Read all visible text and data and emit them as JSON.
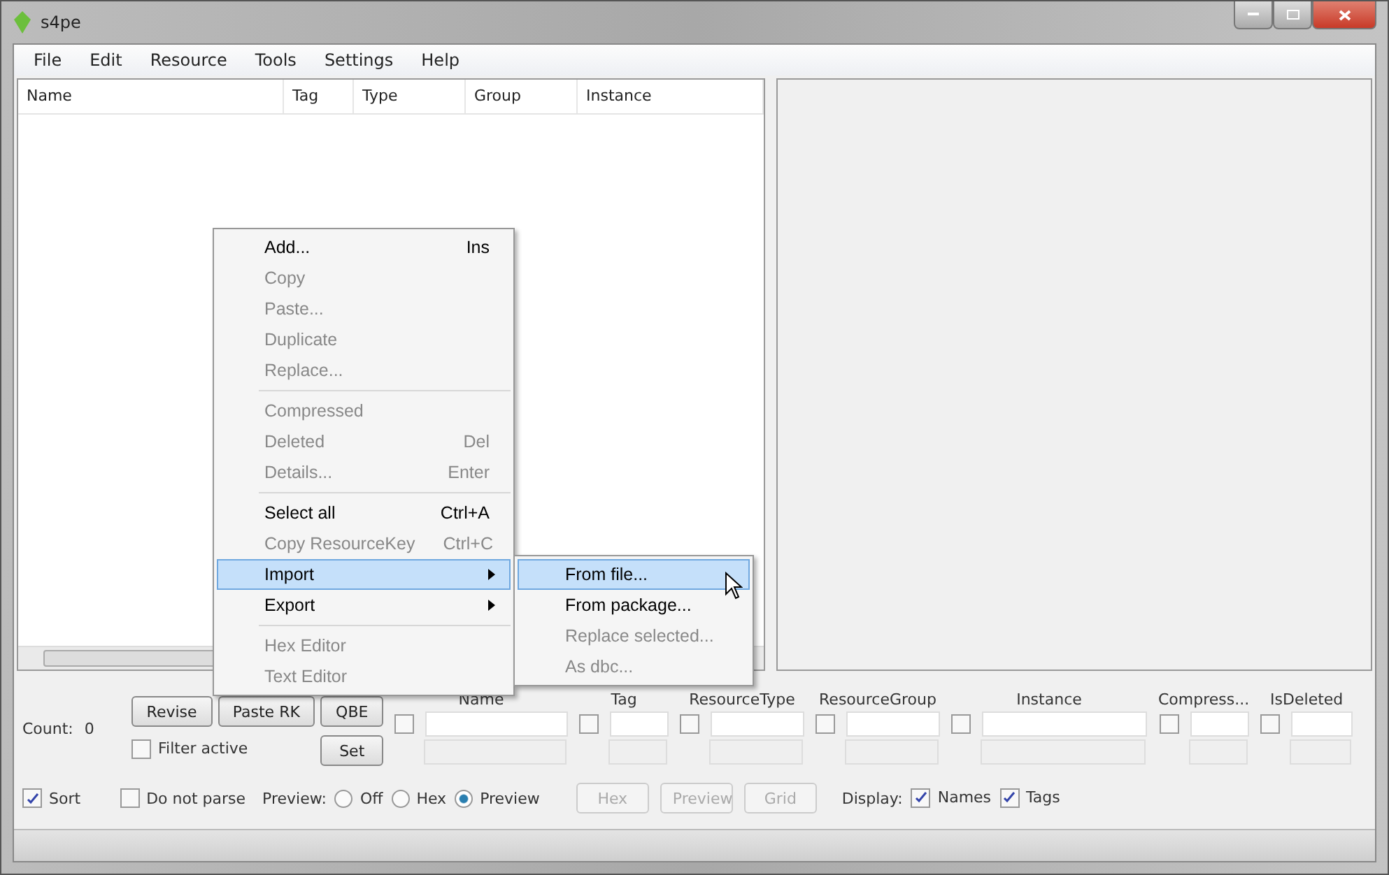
{
  "window": {
    "title": "s4pe"
  },
  "menu_bar": [
    "File",
    "Edit",
    "Resource",
    "Tools",
    "Settings",
    "Help"
  ],
  "list": {
    "columns": [
      "Name",
      "Tag",
      "Type",
      "Group",
      "Instance"
    ]
  },
  "filter_panel": {
    "count_label": "Count:",
    "count_value": "0",
    "buttons": [
      {
        "label": "Revise"
      },
      {
        "label": "Paste RK"
      },
      {
        "label": "QBE"
      },
      {
        "label": "Set"
      }
    ],
    "filter_active": {
      "label": "Filter active",
      "checked": false
    },
    "fields": [
      {
        "label": "Name",
        "checked": false
      },
      {
        "label": "Tag",
        "checked": false
      },
      {
        "label": "ResourceType",
        "checked": false
      },
      {
        "label": "ResourceGroup",
        "checked": false
      },
      {
        "label": "Instance",
        "checked": false
      },
      {
        "label": "Compress...",
        "checked": false
      },
      {
        "label": "IsDeleted",
        "checked": false
      }
    ]
  },
  "options": {
    "sort": {
      "label": "Sort",
      "checked": true
    },
    "do_not_parse": {
      "label": "Do not parse",
      "checked": false
    },
    "preview_label": "Preview:",
    "preview_modes": [
      {
        "label": "Off",
        "selected": false
      },
      {
        "label": "Hex",
        "selected": false
      },
      {
        "label": "Preview",
        "selected": true
      }
    ],
    "view_buttons": [
      {
        "label": "Hex",
        "disabled": true
      },
      {
        "label": "Preview",
        "disabled": true
      },
      {
        "label": "Grid",
        "disabled": true
      }
    ],
    "display_label": "Display:",
    "display": [
      {
        "label": "Names",
        "checked": true
      },
      {
        "label": "Tags",
        "checked": true
      }
    ]
  },
  "context_menu": [
    {
      "kind": "item",
      "label": "Add...",
      "shortcut": "Ins",
      "disabled": false,
      "selected": false
    },
    {
      "kind": "item",
      "label": "Copy",
      "disabled": true,
      "selected": false
    },
    {
      "kind": "item",
      "label": "Paste...",
      "disabled": true,
      "selected": false
    },
    {
      "kind": "item",
      "label": "Duplicate",
      "disabled": true,
      "selected": false
    },
    {
      "kind": "item",
      "label": "Replace...",
      "disabled": true,
      "selected": false
    },
    {
      "kind": "separator"
    },
    {
      "kind": "item",
      "label": "Compressed",
      "disabled": true,
      "selected": false
    },
    {
      "kind": "item",
      "label": "Deleted",
      "shortcut": "Del",
      "disabled": true,
      "selected": false
    },
    {
      "kind": "item",
      "label": "Details...",
      "shortcut": "Enter",
      "disabled": true,
      "selected": false
    },
    {
      "kind": "separator"
    },
    {
      "kind": "item",
      "label": "Select all",
      "shortcut": "Ctrl+A",
      "disabled": false,
      "selected": false
    },
    {
      "kind": "item",
      "label": "Copy ResourceKey",
      "shortcut": "Ctrl+C",
      "disabled": true,
      "selected": false
    },
    {
      "kind": "submenu",
      "label": "Import",
      "disabled": false,
      "selected": true
    },
    {
      "kind": "submenu",
      "label": "Export",
      "disabled": false,
      "selected": false
    },
    {
      "kind": "separator"
    },
    {
      "kind": "item",
      "label": "Hex Editor",
      "disabled": true,
      "selected": false
    },
    {
      "kind": "item",
      "label": "Text Editor",
      "disabled": true,
      "selected": false
    }
  ],
  "submenu": [
    {
      "label": "From file...",
      "disabled": false,
      "selected": true
    },
    {
      "label": "From package...",
      "disabled": false,
      "selected": false
    },
    {
      "label": "Replace selected...",
      "disabled": true,
      "selected": false
    },
    {
      "label": "As dbc...",
      "disabled": true,
      "selected": false
    }
  ]
}
